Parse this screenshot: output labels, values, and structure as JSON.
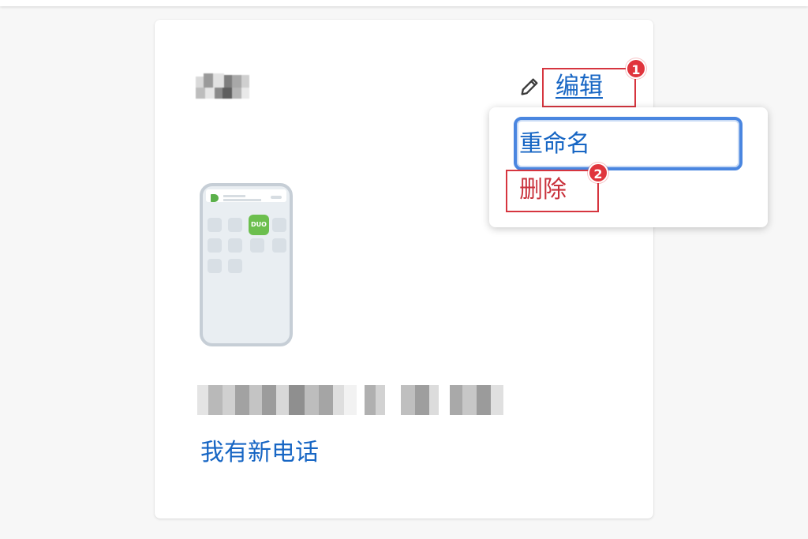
{
  "card": {
    "edit_label": "编辑",
    "new_phone_label": "我有新电话",
    "phone_app_label": "DUO"
  },
  "dropdown": {
    "rename_label": "重命名",
    "delete_label": "删除"
  },
  "annotations": {
    "badge_1": "1",
    "badge_2": "2"
  },
  "colors": {
    "link": "#1766c4",
    "delete": "#c9323c",
    "annotation": "#d6353f",
    "focus_ring": "#4a86e0",
    "duo_green": "#6cbf4e"
  }
}
